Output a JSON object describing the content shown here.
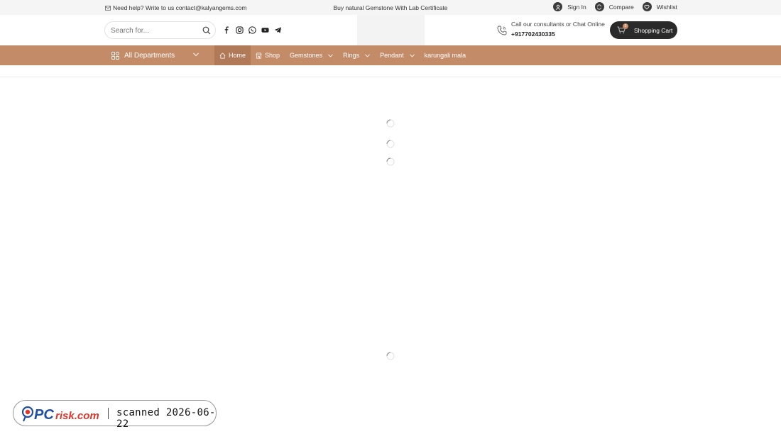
{
  "topbar": {
    "help_text": "Need help? Write to us contact@kalyangems.com",
    "promo_text": "Buy natural Gemstone With Lab Certificate",
    "account": {
      "sign_in": "Sign In",
      "compare": "Compare",
      "wishlist": "Wishlist"
    }
  },
  "header": {
    "search": {
      "placeholder": "Search for..."
    },
    "socials": [
      "facebook-icon",
      "instagram-icon",
      "whatsapp-icon",
      "youtube-icon",
      "telegram-icon"
    ],
    "contact": {
      "line1": "Call our consultants or Chat Online",
      "phone": "+917702430335"
    },
    "cart": {
      "label": "Shopping Cart",
      "count": "0"
    }
  },
  "nav": {
    "departments_label": "All Departments",
    "items": [
      {
        "label": "Home",
        "icon": "home-icon",
        "active": true,
        "dropdown": false
      },
      {
        "label": "Shop",
        "icon": "shop-icon",
        "active": false,
        "dropdown": false
      },
      {
        "label": "Gemstones",
        "active": false,
        "dropdown": true
      },
      {
        "label": "Rings",
        "active": false,
        "dropdown": true
      },
      {
        "label": "Pendant",
        "active": false,
        "dropdown": true
      },
      {
        "label": "karungali mala",
        "active": false,
        "dropdown": false
      }
    ]
  },
  "watermark": {
    "brand": "PCrisk.com",
    "scan_text": "scanned 2026-06-22"
  },
  "colors": {
    "nav_bg": "#c38b68",
    "nav_active": "#b07a59",
    "cart_bg": "#2a2a2a",
    "topbar_bg": "#f5f5f5"
  }
}
